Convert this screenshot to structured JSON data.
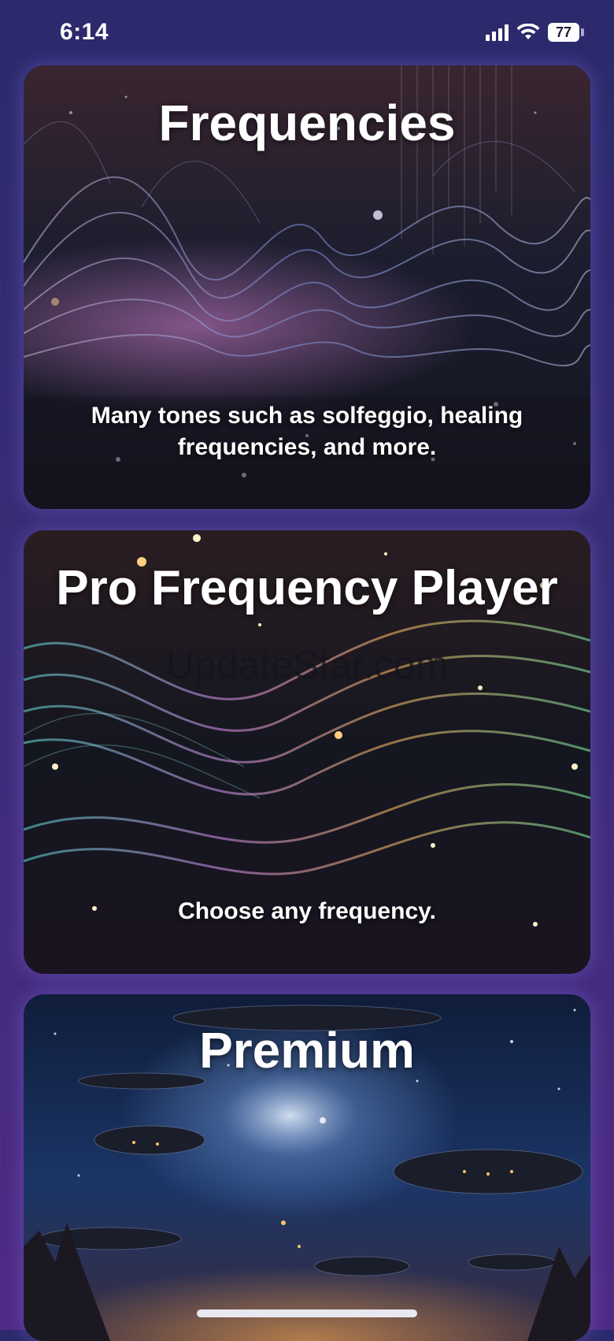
{
  "status_bar": {
    "time": "6:14",
    "battery": "77",
    "icons": [
      "signal-icon",
      "wifi-icon",
      "battery-icon"
    ]
  },
  "cards": [
    {
      "title": "Frequencies",
      "subtitle": "Many tones such as solfeggio, healing frequencies, and more."
    },
    {
      "title": "Pro Frequency Player",
      "subtitle": "Choose any frequency.",
      "watermark": "UpdateStar.com"
    },
    {
      "title": "Premium"
    }
  ],
  "colors": {
    "background_top": "#2b2a6c",
    "background_bottom": "#4f2b86",
    "text": "#ffffff"
  }
}
